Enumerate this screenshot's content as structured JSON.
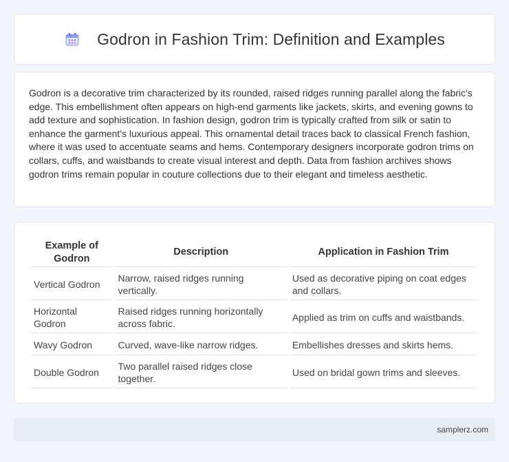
{
  "header": {
    "icon": "calendar-icon",
    "title": "Godron in Fashion Trim: Definition and Examples"
  },
  "intro": {
    "text": "Godron is a decorative trim characterized by its rounded, raised ridges running parallel along the fabric's edge. This embellishment often appears on high-end garments like jackets, skirts, and evening gowns to add texture and sophistication. In fashion design, godron trim is typically crafted from silk or satin to enhance the garment's luxurious appeal. This ornamental detail traces back to classical French fashion, where it was used to accentuate seams and hems. Contemporary designers incorporate godron trims on collars, cuffs, and waistbands to create visual interest and depth. Data from fashion archives shows godron trims remain popular in couture collections due to their elegant and timeless aesthetic."
  },
  "table": {
    "headers": [
      "Example of Godron",
      "Description",
      "Application in Fashion Trim"
    ],
    "rows": [
      [
        "Vertical Godron",
        "Narrow, raised ridges running vertically.",
        "Used as decorative piping on coat edges and collars."
      ],
      [
        "Horizontal Godron",
        "Raised ridges running horizontally across fabric.",
        "Applied as trim on cuffs and waistbands."
      ],
      [
        "Wavy Godron",
        "Curved, wave-like narrow ridges.",
        "Embellishes dresses and skirts hems."
      ],
      [
        "Double Godron",
        "Two parallel raised ridges close together.",
        "Used on bridal gown trims and sleeves."
      ]
    ]
  },
  "footer": {
    "site": "samplerz.com"
  }
}
